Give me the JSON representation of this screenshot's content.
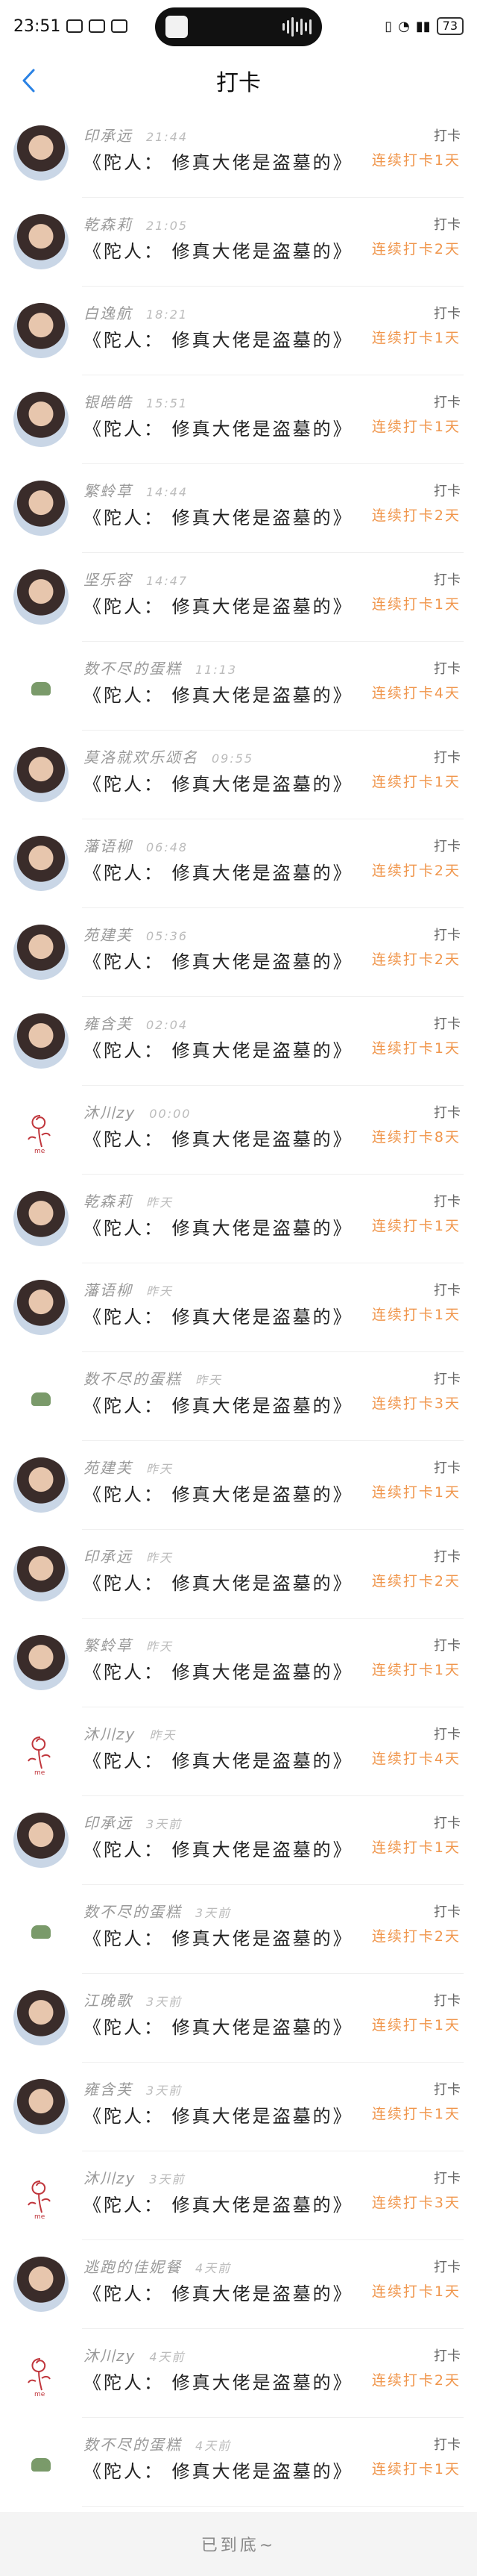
{
  "status": {
    "time": "23:51",
    "battery": "73"
  },
  "nav": {
    "title": "打卡"
  },
  "rows": [
    {
      "name": "印承远",
      "time": "21:44",
      "book": "《陀人：  修真大佬是盗墓的》",
      "type": "打卡",
      "streak": "连续打卡1天",
      "avatar": "photo"
    },
    {
      "name": "乾森莉",
      "time": "21:05",
      "book": "《陀人：  修真大佬是盗墓的》",
      "type": "打卡",
      "streak": "连续打卡2天",
      "avatar": "photo"
    },
    {
      "name": "白逸航",
      "time": "18:21",
      "book": "《陀人：  修真大佬是盗墓的》",
      "type": "打卡",
      "streak": "连续打卡1天",
      "avatar": "photo"
    },
    {
      "name": "银皓皓",
      "time": "15:51",
      "book": "《陀人：  修真大佬是盗墓的》",
      "type": "打卡",
      "streak": "连续打卡1天",
      "avatar": "photo"
    },
    {
      "name": "繁蛉草",
      "time": "14:44",
      "book": "《陀人：  修真大佬是盗墓的》",
      "type": "打卡",
      "streak": "连续打卡2天",
      "avatar": "photo"
    },
    {
      "name": "坚乐容",
      "time": "14:47",
      "book": "《陀人：  修真大佬是盗墓的》",
      "type": "打卡",
      "streak": "连续打卡1天",
      "avatar": "photo"
    },
    {
      "name": "数不尽的蛋糕",
      "time": "11:13",
      "book": "《陀人：  修真大佬是盗墓的》",
      "type": "打卡",
      "streak": "连续打卡4天",
      "avatar": "plain"
    },
    {
      "name": "莫洛就欢乐颂名",
      "time": "09:55",
      "book": "《陀人：  修真大佬是盗墓的》",
      "type": "打卡",
      "streak": "连续打卡1天",
      "avatar": "photo"
    },
    {
      "name": "藩语柳",
      "time": "06:48",
      "book": "《陀人：  修真大佬是盗墓的》",
      "type": "打卡",
      "streak": "连续打卡2天",
      "avatar": "photo"
    },
    {
      "name": "苑建芙",
      "time": "05:36",
      "book": "《陀人：  修真大佬是盗墓的》",
      "type": "打卡",
      "streak": "连续打卡2天",
      "avatar": "photo"
    },
    {
      "name": "雍含芙",
      "time": "02:04",
      "book": "《陀人：  修真大佬是盗墓的》",
      "type": "打卡",
      "streak": "连续打卡1天",
      "avatar": "photo"
    },
    {
      "name": "沐川zy",
      "time": "00:00",
      "book": "《陀人：  修真大佬是盗墓的》",
      "type": "打卡",
      "streak": "连续打卡8天",
      "avatar": "rose"
    },
    {
      "name": "乾森莉",
      "time": "昨天",
      "book": "《陀人：  修真大佬是盗墓的》",
      "type": "打卡",
      "streak": "连续打卡1天",
      "avatar": "photo"
    },
    {
      "name": "藩语柳",
      "time": "昨天",
      "book": "《陀人：  修真大佬是盗墓的》",
      "type": "打卡",
      "streak": "连续打卡1天",
      "avatar": "photo"
    },
    {
      "name": "数不尽的蛋糕",
      "time": "昨天",
      "book": "《陀人：  修真大佬是盗墓的》",
      "type": "打卡",
      "streak": "连续打卡3天",
      "avatar": "plain"
    },
    {
      "name": "苑建芙",
      "time": "昨天",
      "book": "《陀人：  修真大佬是盗墓的》",
      "type": "打卡",
      "streak": "连续打卡1天",
      "avatar": "photo"
    },
    {
      "name": "印承远",
      "time": "昨天",
      "book": "《陀人：  修真大佬是盗墓的》",
      "type": "打卡",
      "streak": "连续打卡2天",
      "avatar": "photo"
    },
    {
      "name": "繁蛉草",
      "time": "昨天",
      "book": "《陀人：  修真大佬是盗墓的》",
      "type": "打卡",
      "streak": "连续打卡1天",
      "avatar": "photo"
    },
    {
      "name": "沐川zy",
      "time": "昨天",
      "book": "《陀人：  修真大佬是盗墓的》",
      "type": "打卡",
      "streak": "连续打卡4天",
      "avatar": "rose"
    },
    {
      "name": "印承远",
      "time": "3天前",
      "book": "《陀人：  修真大佬是盗墓的》",
      "type": "打卡",
      "streak": "连续打卡1天",
      "avatar": "photo"
    },
    {
      "name": "数不尽的蛋糕",
      "time": "3天前",
      "book": "《陀人：  修真大佬是盗墓的》",
      "type": "打卡",
      "streak": "连续打卡2天",
      "avatar": "plain"
    },
    {
      "name": "江晚歌",
      "time": "3天前",
      "book": "《陀人：  修真大佬是盗墓的》",
      "type": "打卡",
      "streak": "连续打卡1天",
      "avatar": "photo"
    },
    {
      "name": "雍含芙",
      "time": "3天前",
      "book": "《陀人：  修真大佬是盗墓的》",
      "type": "打卡",
      "streak": "连续打卡1天",
      "avatar": "photo"
    },
    {
      "name": "沐川zy",
      "time": "3天前",
      "book": "《陀人：  修真大佬是盗墓的》",
      "type": "打卡",
      "streak": "连续打卡3天",
      "avatar": "rose"
    },
    {
      "name": "逃跑的佳妮餐",
      "time": "4天前",
      "book": "《陀人：  修真大佬是盗墓的》",
      "type": "打卡",
      "streak": "连续打卡1天",
      "avatar": "photo"
    },
    {
      "name": "沐川zy",
      "time": "4天前",
      "book": "《陀人：  修真大佬是盗墓的》",
      "type": "打卡",
      "streak": "连续打卡2天",
      "avatar": "rose"
    },
    {
      "name": "数不尽的蛋糕",
      "time": "4天前",
      "book": "《陀人：  修真大佬是盗墓的》",
      "type": "打卡",
      "streak": "连续打卡1天",
      "avatar": "plain"
    }
  ],
  "footer": {
    "text": "已到底~"
  },
  "colors": {
    "accent": "#f0964c",
    "nav": "#2a82e4"
  }
}
